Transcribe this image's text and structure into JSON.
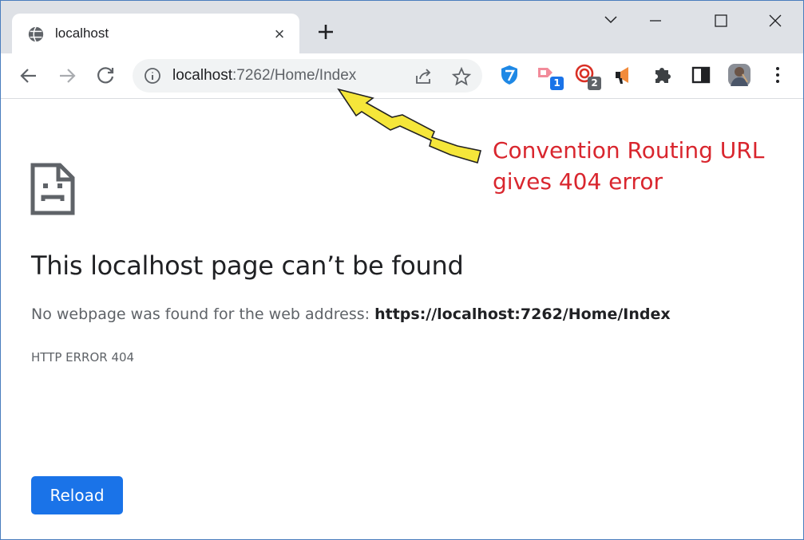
{
  "browser": {
    "tab": {
      "title": "localhost",
      "favicon": "globe-icon",
      "close": "×"
    },
    "new_tab": "plus-icon",
    "window_controls": [
      "chevron-down-icon",
      "minimize-icon",
      "maximize-icon",
      "close-icon"
    ],
    "toolbar": {
      "back": "back-arrow-icon",
      "forward": "forward-arrow-icon",
      "reload": "reload-icon",
      "url_host": "localhost",
      "url_path": ":7262/Home/Index",
      "extensions": [
        {
          "name": "shield-extension-icon",
          "badge": ""
        },
        {
          "name": "tag-extension-icon",
          "badge": "1"
        },
        {
          "name": "spiral-extension-icon",
          "badge": "2"
        },
        {
          "name": "megaphone-extension-icon",
          "badge": ""
        },
        {
          "name": "puzzle-extension-icon",
          "badge": ""
        },
        {
          "name": "side-panel-icon",
          "badge": ""
        },
        {
          "name": "profile-avatar",
          "badge": ""
        },
        {
          "name": "menu-kebab-icon",
          "badge": ""
        }
      ]
    }
  },
  "page": {
    "title": "This localhost page can’t be found",
    "message_prefix": "No webpage was found for the web address: ",
    "message_url": "https://localhost:7262/Home/Index",
    "error_code": "HTTP ERROR 404",
    "reload_label": "Reload"
  },
  "annotation": {
    "line1": "Convention Routing URL",
    "line2": "gives 404 error",
    "color": "#d9262e",
    "arrow_color": "#f5e63a"
  },
  "colors": {
    "accent": "#1a73e8",
    "tabstrip": "#dee1e6"
  }
}
